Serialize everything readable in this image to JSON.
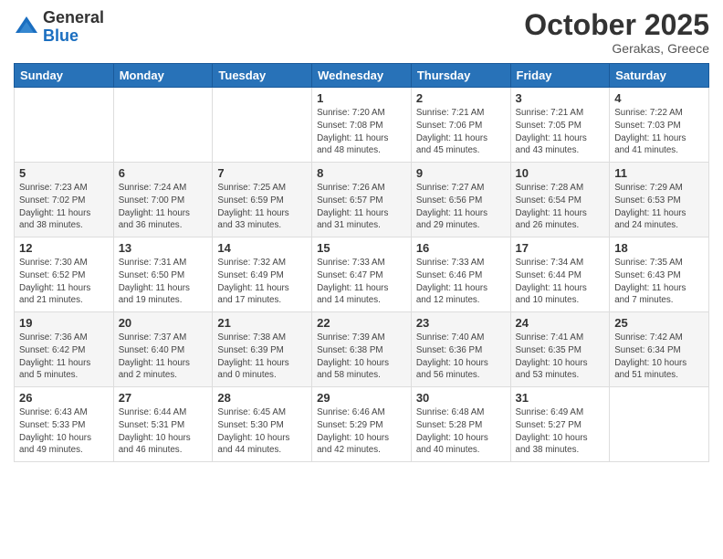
{
  "logo": {
    "general": "General",
    "blue": "Blue"
  },
  "header": {
    "month": "October 2025",
    "location": "Gerakas, Greece"
  },
  "weekdays": [
    "Sunday",
    "Monday",
    "Tuesday",
    "Wednesday",
    "Thursday",
    "Friday",
    "Saturday"
  ],
  "weeks": [
    [
      {
        "day": "",
        "info": ""
      },
      {
        "day": "",
        "info": ""
      },
      {
        "day": "",
        "info": ""
      },
      {
        "day": "1",
        "info": "Sunrise: 7:20 AM\nSunset: 7:08 PM\nDaylight: 11 hours\nand 48 minutes."
      },
      {
        "day": "2",
        "info": "Sunrise: 7:21 AM\nSunset: 7:06 PM\nDaylight: 11 hours\nand 45 minutes."
      },
      {
        "day": "3",
        "info": "Sunrise: 7:21 AM\nSunset: 7:05 PM\nDaylight: 11 hours\nand 43 minutes."
      },
      {
        "day": "4",
        "info": "Sunrise: 7:22 AM\nSunset: 7:03 PM\nDaylight: 11 hours\nand 41 minutes."
      }
    ],
    [
      {
        "day": "5",
        "info": "Sunrise: 7:23 AM\nSunset: 7:02 PM\nDaylight: 11 hours\nand 38 minutes."
      },
      {
        "day": "6",
        "info": "Sunrise: 7:24 AM\nSunset: 7:00 PM\nDaylight: 11 hours\nand 36 minutes."
      },
      {
        "day": "7",
        "info": "Sunrise: 7:25 AM\nSunset: 6:59 PM\nDaylight: 11 hours\nand 33 minutes."
      },
      {
        "day": "8",
        "info": "Sunrise: 7:26 AM\nSunset: 6:57 PM\nDaylight: 11 hours\nand 31 minutes."
      },
      {
        "day": "9",
        "info": "Sunrise: 7:27 AM\nSunset: 6:56 PM\nDaylight: 11 hours\nand 29 minutes."
      },
      {
        "day": "10",
        "info": "Sunrise: 7:28 AM\nSunset: 6:54 PM\nDaylight: 11 hours\nand 26 minutes."
      },
      {
        "day": "11",
        "info": "Sunrise: 7:29 AM\nSunset: 6:53 PM\nDaylight: 11 hours\nand 24 minutes."
      }
    ],
    [
      {
        "day": "12",
        "info": "Sunrise: 7:30 AM\nSunset: 6:52 PM\nDaylight: 11 hours\nand 21 minutes."
      },
      {
        "day": "13",
        "info": "Sunrise: 7:31 AM\nSunset: 6:50 PM\nDaylight: 11 hours\nand 19 minutes."
      },
      {
        "day": "14",
        "info": "Sunrise: 7:32 AM\nSunset: 6:49 PM\nDaylight: 11 hours\nand 17 minutes."
      },
      {
        "day": "15",
        "info": "Sunrise: 7:33 AM\nSunset: 6:47 PM\nDaylight: 11 hours\nand 14 minutes."
      },
      {
        "day": "16",
        "info": "Sunrise: 7:33 AM\nSunset: 6:46 PM\nDaylight: 11 hours\nand 12 minutes."
      },
      {
        "day": "17",
        "info": "Sunrise: 7:34 AM\nSunset: 6:44 PM\nDaylight: 11 hours\nand 10 minutes."
      },
      {
        "day": "18",
        "info": "Sunrise: 7:35 AM\nSunset: 6:43 PM\nDaylight: 11 hours\nand 7 minutes."
      }
    ],
    [
      {
        "day": "19",
        "info": "Sunrise: 7:36 AM\nSunset: 6:42 PM\nDaylight: 11 hours\nand 5 minutes."
      },
      {
        "day": "20",
        "info": "Sunrise: 7:37 AM\nSunset: 6:40 PM\nDaylight: 11 hours\nand 2 minutes."
      },
      {
        "day": "21",
        "info": "Sunrise: 7:38 AM\nSunset: 6:39 PM\nDaylight: 11 hours\nand 0 minutes."
      },
      {
        "day": "22",
        "info": "Sunrise: 7:39 AM\nSunset: 6:38 PM\nDaylight: 10 hours\nand 58 minutes."
      },
      {
        "day": "23",
        "info": "Sunrise: 7:40 AM\nSunset: 6:36 PM\nDaylight: 10 hours\nand 56 minutes."
      },
      {
        "day": "24",
        "info": "Sunrise: 7:41 AM\nSunset: 6:35 PM\nDaylight: 10 hours\nand 53 minutes."
      },
      {
        "day": "25",
        "info": "Sunrise: 7:42 AM\nSunset: 6:34 PM\nDaylight: 10 hours\nand 51 minutes."
      }
    ],
    [
      {
        "day": "26",
        "info": "Sunrise: 6:43 AM\nSunset: 5:33 PM\nDaylight: 10 hours\nand 49 minutes."
      },
      {
        "day": "27",
        "info": "Sunrise: 6:44 AM\nSunset: 5:31 PM\nDaylight: 10 hours\nand 46 minutes."
      },
      {
        "day": "28",
        "info": "Sunrise: 6:45 AM\nSunset: 5:30 PM\nDaylight: 10 hours\nand 44 minutes."
      },
      {
        "day": "29",
        "info": "Sunrise: 6:46 AM\nSunset: 5:29 PM\nDaylight: 10 hours\nand 42 minutes."
      },
      {
        "day": "30",
        "info": "Sunrise: 6:48 AM\nSunset: 5:28 PM\nDaylight: 10 hours\nand 40 minutes."
      },
      {
        "day": "31",
        "info": "Sunrise: 6:49 AM\nSunset: 5:27 PM\nDaylight: 10 hours\nand 38 minutes."
      },
      {
        "day": "",
        "info": ""
      }
    ]
  ]
}
